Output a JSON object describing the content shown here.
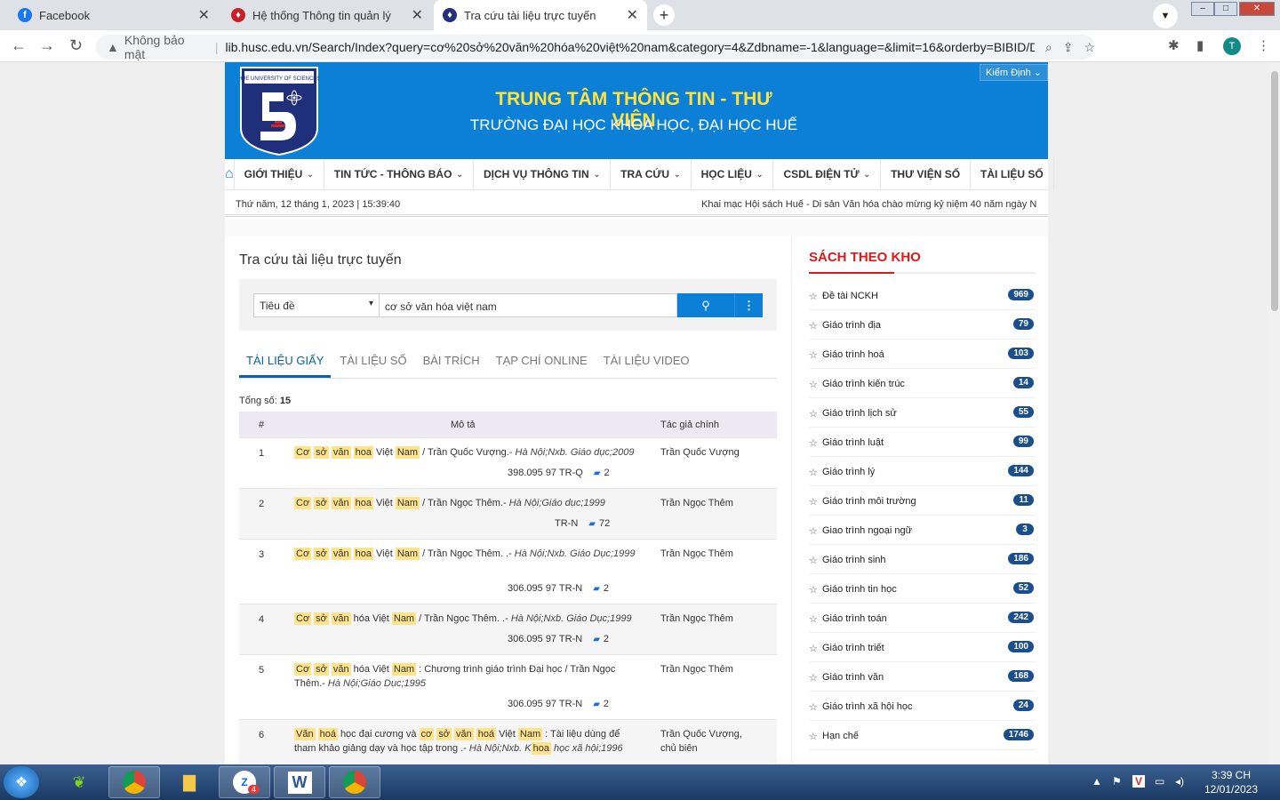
{
  "browser": {
    "tabs": [
      {
        "title": "Facebook",
        "icon": "facebook-icon"
      },
      {
        "title": "Hệ thống Thông tin quản lý",
        "icon": "shield-icon"
      },
      {
        "title": "Tra cứu tài liệu trực tuyến",
        "icon": "shield-icon"
      }
    ],
    "security_label": "Không bảo mật",
    "url": "lib.husc.edu.vn/Search/Index?query=cơ%20sở%20văn%20hóa%20việt%20nam&category=4&Zdbname=-1&language=&limit=16&orderby=BIBID/DES...",
    "profile_initial": "T"
  },
  "site": {
    "kiem_dinh": "Kiểm Định",
    "title": "TRUNG TÂM THÔNG TIN - THƯ VIỆN",
    "subtitle": "TRƯỜNG ĐẠI HỌC KHOA HỌC, ĐẠI HỌC HUẾ",
    "menu": [
      "GIỚI THIỆU",
      "TIN TỨC - THÔNG BÁO",
      "DỊCH VỤ THÔNG TIN",
      "TRA CỨU",
      "HỌC LIỆU",
      "CSDL ĐIỆN TỬ",
      "THƯ VIỆN SỐ",
      "TÀI LIỆU SỐ"
    ],
    "date": "Thứ năm, 12 tháng 1, 2023 | 15:39:40",
    "marquee": "Khai mạc Hội sách Huế - Di sản Văn hóa chào mừng kỷ niệm 40 năm ngày N"
  },
  "search": {
    "heading": "Tra cứu tài liệu trực tuyến",
    "field": "Tiêu đề",
    "query": "cơ sở văn hóa việt nam"
  },
  "results": {
    "tabs": [
      "TÀI LIỆU GIẤY",
      "TÀI LIỆU SỐ",
      "BÀI TRÍCH",
      "TẠP CHÍ ONLINE",
      "TÀI LIỆU VIDEO"
    ],
    "total_label": "Tổng số:",
    "total": "15",
    "col_num": "#",
    "col_desc": "Mô tả",
    "col_author": "Tác giả chính",
    "rows": [
      {
        "n": "1",
        "rest": "Việt",
        "title_tail": "/ Trần Quốc Vượng.-",
        "pub": "Hà Nội;Nxb. Giáo dục;2009",
        "call": "398.095 97 TR-Q",
        "copies": "2",
        "author": "Trần Quốc Vượng"
      },
      {
        "n": "2",
        "rest": "Việt",
        "title_tail": "/ Trần Ngọc Thêm.-",
        "pub": "Hà Nội;Giáo dục;1999",
        "call": "TR-N",
        "copies": "72",
        "author": "Trần Ngọc Thêm"
      },
      {
        "n": "3",
        "rest": "Việt",
        "title_tail": "/ Trần Ngọc Thêm. .-",
        "pub": "Hà Nội;Nxb. Giáo Dục;1999",
        "call": "306.095 97 TR-N",
        "copies": "2",
        "author": "Trần Ngọc Thêm"
      },
      {
        "n": "4",
        "rest": "hóa Việt",
        "title_tail": "/ Trần Ngọc Thêm. .-",
        "pub": "Hà Nội;Nxb. Giáo Dục;1999",
        "call": "306.095 97 TR-N",
        "copies": "2",
        "author": "Trần Ngọc Thêm"
      },
      {
        "n": "5",
        "rest": "hóa Việt",
        "title_tail": ": Chương trình giáo trình Đại học / Trần Ngọc Thêm.-",
        "pub": "Hà Nội;Giáo Dục;1995",
        "call": "306.095 97 TR-N",
        "copies": "2",
        "author": "Trần Ngọc Thêm"
      },
      {
        "n": "6",
        "author": "Trần Quốc Vượng, chủ biên"
      }
    ],
    "row6": {
      "w1": "Văn",
      "w2": "hoá",
      "t1": "học đại cương và",
      "w3": "cơ",
      "w4": "sở",
      "w5": "văn",
      "w6": "hoá",
      "t2": "Việt",
      "w7": "Nam",
      "t3": ": Tài liệu dùng để tham khảo giảng dạy và học tập trong .-",
      "pub": "Hà Nội;Nxb. K",
      "w8": "hoa",
      "pub2": "học xã hội;1996"
    },
    "hl": {
      "co": "Cơ",
      "so": "sở",
      "van": "văn",
      "hoa": "hoa",
      "nam": "Nam"
    }
  },
  "sidebar": {
    "heading": "SÁCH THEO KHO",
    "items": [
      {
        "label": "Đề tài NCKH",
        "count": "969"
      },
      {
        "label": "Giáo trình địa",
        "count": "79"
      },
      {
        "label": "Giáo trình hoá",
        "count": "103"
      },
      {
        "label": "Giáo trình kiến trúc",
        "count": "14"
      },
      {
        "label": "Giáo trình lịch sử",
        "count": "55"
      },
      {
        "label": "Giáo trình luật",
        "count": "99"
      },
      {
        "label": "Giáo trình lý",
        "count": "144"
      },
      {
        "label": "Giáo trình môi trường",
        "count": "11"
      },
      {
        "label": "Giao trình ngoại ngữ",
        "count": "3"
      },
      {
        "label": "Giáo trình sinh",
        "count": "186"
      },
      {
        "label": "Giáo trình tin học",
        "count": "52"
      },
      {
        "label": "Giáo trình toán",
        "count": "242"
      },
      {
        "label": "Giáo trình triết",
        "count": "100"
      },
      {
        "label": "Giáo trình văn",
        "count": "168"
      },
      {
        "label": "Giáo trình xã hội học",
        "count": "24"
      },
      {
        "label": "Hạn chế",
        "count": "1746"
      }
    ]
  },
  "taskbar": {
    "zalo_badge": "4",
    "time": "3:39 CH",
    "date": "12/01/2023"
  }
}
